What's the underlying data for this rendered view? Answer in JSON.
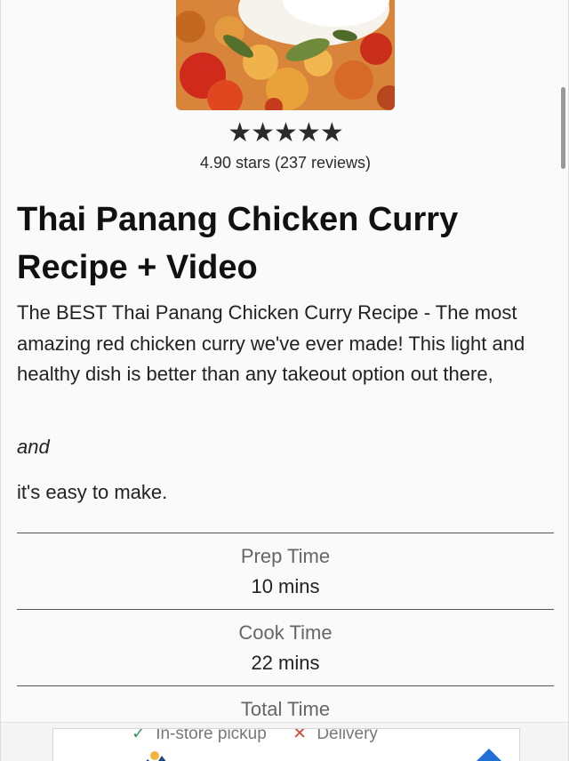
{
  "recipe": {
    "rating": {
      "stars_display": "★★★★★",
      "stars_value": 5,
      "text": "4.90 stars (237 reviews)"
    },
    "title": "Thai Panang Chicken Curry Recipe + Video",
    "description": "The BEST Thai Panang Chicken Curry Recipe - The most amazing red chicken curry we've ever made! This light and healthy dish is better than any takeout option out there,",
    "description_em": "and",
    "description_end": "it's easy to make.",
    "times": [
      {
        "label": "Prep Time",
        "value": "10 mins"
      },
      {
        "label": "Cook Time",
        "value": "22 mins"
      },
      {
        "label": "Total Time",
        "value": ""
      }
    ]
  },
  "ad": {
    "option_1": "In-store pickup",
    "option_2": "Delivery",
    "check_icon": "check-icon",
    "x_icon": "x-icon"
  },
  "colors": {
    "accent_green": "#3b9a64",
    "accent_red": "#d24a3c",
    "star_color": "#2a2a2a"
  }
}
